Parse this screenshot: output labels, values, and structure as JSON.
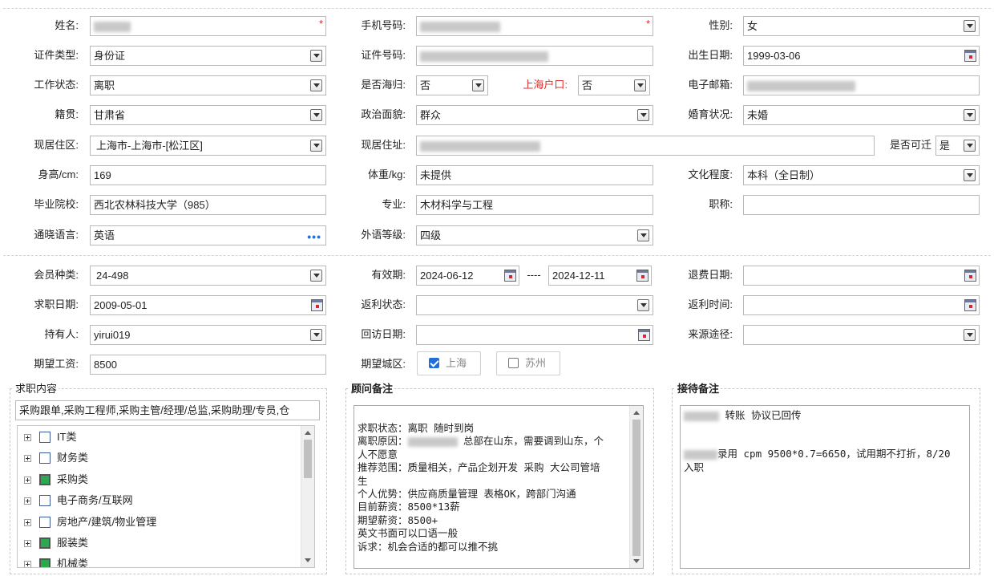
{
  "row1": {
    "name_label": "姓名:",
    "phone_label": "手机号码:",
    "gender_label": "性别:",
    "gender_value": "女"
  },
  "row2": {
    "idtype_label": "证件类型:",
    "idtype_value": "身份证",
    "idno_label": "证件号码:",
    "birth_label": "出生日期:",
    "birth_value": "1999-03-06"
  },
  "row3": {
    "work_label": "工作状态:",
    "work_value": "离职",
    "overseas_label": "是否海归:",
    "overseas_value": "否",
    "shhukou_label": "上海户口:",
    "shhukou_value": "否",
    "email_label": "电子邮箱:"
  },
  "row4": {
    "native_label": "籍贯:",
    "native_value": "甘肃省",
    "political_label": "政治面貌:",
    "political_value": "群众",
    "marital_label": "婚育状况:",
    "marital_value": "未婚"
  },
  "row5": {
    "area_label": "现居住区:",
    "area_value": "上海市-上海市-[松江区]",
    "addr_label": "现居住址:",
    "relocate_label": "是否可迁",
    "relocate_value": "是"
  },
  "row6": {
    "height_label": "身高/cm:",
    "height_value": "169",
    "weight_label": "体重/kg:",
    "weight_value": "未提供",
    "edu_label": "文化程度:",
    "edu_value": "本科（全日制）"
  },
  "row7": {
    "school_label": "毕业院校:",
    "school_value": "西北农林科技大学（985）",
    "major_label": "专业:",
    "major_value": "木材科学与工程",
    "title_label": "职称:"
  },
  "row8": {
    "lang_label": "通晓语言:",
    "lang_value": "英语",
    "level_label": "外语等级:",
    "level_value": "四级"
  },
  "row9": {
    "member_label": "会员种类:",
    "member_value": "24-498",
    "valid_label": "有效期:",
    "valid_from": "2024-06-12",
    "valid_sep": "----",
    "valid_to": "2024-12-11",
    "refund_label": "退费日期:"
  },
  "row10": {
    "jobdate_label": "求职日期:",
    "jobdate_value": "2009-05-01",
    "rebate_label": "返利状态:",
    "rebate_time_label": "返利时间:"
  },
  "row11": {
    "holder_label": "持有人:",
    "holder_value": "yirui019",
    "visit_label": "回访日期:",
    "source_label": "来源途径:"
  },
  "row12": {
    "salary_label": "期望工资:",
    "salary_value": "8500",
    "city_label": "期望城区:",
    "city_shanghai": "上海",
    "city_suzhou": "苏州"
  },
  "job_content": {
    "title": "求职内容",
    "summary": "采购跟单,采购工程师,采购主管/经理/总监,采购助理/专员,仓",
    "tree": [
      "IT类",
      "财务类",
      "采购类",
      "电子商务/互联网",
      "房地产/建筑/物业管理",
      "服装类",
      "机械类"
    ]
  },
  "consultant": {
    "title": "顾问备注",
    "lines": [
      "求职状态：离职 随时到岗",
      "离职原因：",
      "人不愿意",
      "推荐范围：质量相关，产品企划开发 采购 大公司管培",
      "生",
      "个人优势：供应商质量管理  表格OK，跨部门沟通",
      "目前薪资：8500*13薪",
      "期望薪资：8500+",
      "英文书面可以口语一般",
      "诉求：机会合适的都可以推不挑"
    ],
    "line2_tail": " 总部在山东，需要调到山东，个"
  },
  "reception": {
    "title": "接待备注",
    "line1": "  转账  协议已回传",
    "line2": "录用 cpm  9500*0.7=6650，试用期不打折，8/20",
    "line3": "入职"
  },
  "colors": {
    "accent": "#1e6fd9",
    "required": "#e22222",
    "label_red": "#d9302c",
    "checked_tree": "#2da84f"
  }
}
